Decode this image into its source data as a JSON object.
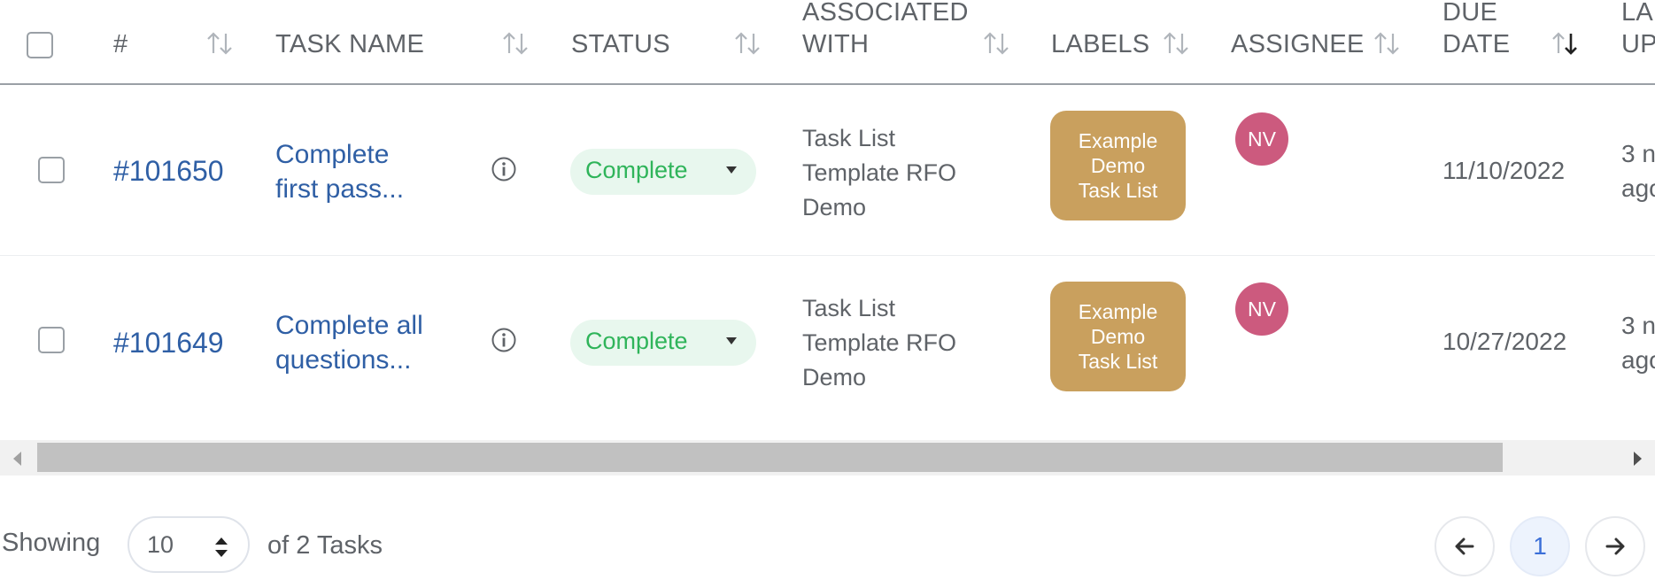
{
  "header": {
    "columns": {
      "id": "#",
      "task_name": "TASK NAME",
      "status": "STATUS",
      "associated_with": "ASSOCIATED\nWITH",
      "labels": "LABELS",
      "assignee": "ASSIGNEE",
      "due_date": "DUE\nDATE",
      "last_updated": "LA\nUP"
    }
  },
  "rows": [
    {
      "id": "#101650",
      "task_name": "Complete\nfirst pass...",
      "status": "Complete",
      "associated_with": "Task List\nTemplate RFO\nDemo",
      "label": "Example\nDemo\nTask List",
      "assignee_initials": "NV",
      "due_date": "11/10/2022",
      "last_updated": "3 n\nago"
    },
    {
      "id": "#101649",
      "task_name": "Complete all\nquestions...",
      "status": "Complete",
      "associated_with": "Task List\nTemplate RFO\nDemo",
      "label": "Example\nDemo\nTask List",
      "assignee_initials": "NV",
      "due_date": "10/27/2022",
      "last_updated": "3 n\nago"
    }
  ],
  "footer": {
    "showing_label": "Showing",
    "page_size": "10",
    "of_label": "of 2 Tasks",
    "current_page": "1"
  },
  "colors": {
    "link": "#2f5fa5",
    "status_bg": "#e8f7ee",
    "status_text": "#2fb45a",
    "label_badge": "#c9a05e",
    "avatar": "#cc5a7e",
    "pager_active": "#3b6fd8"
  },
  "icons": {
    "sort": "sort-arrows-icon",
    "sort_desc": "sort-desc-icon",
    "info": "info-icon",
    "prev": "arrow-left-icon",
    "next": "arrow-right-icon",
    "page_size_select": "up-down-caret-icon"
  }
}
